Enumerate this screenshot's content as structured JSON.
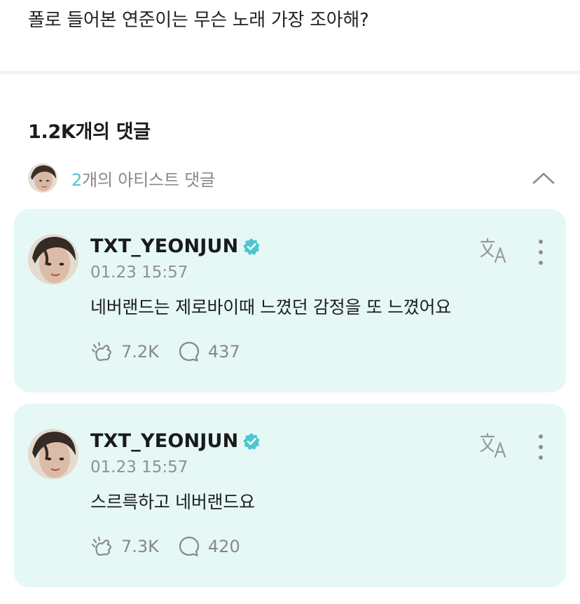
{
  "post": {
    "text": "폴로 들어본 연준이는 무슨 노래 가장 조아해?"
  },
  "comments_header": {
    "count_title": "1.2K개의 댓글",
    "artist_count": "2",
    "artist_label": "개의 아티스트 댓글"
  },
  "comments": [
    {
      "author": "TXT_YEONJUN",
      "time": "01.23 15:57",
      "body": "네버랜드는 제로바이때 느꼈던 감정을 또 느꼈어요",
      "likes": "7.2K",
      "replies": "437"
    },
    {
      "author": "TXT_YEONJUN",
      "time": "01.23 15:57",
      "body": "스르륵하고 네버랜드요",
      "likes": "7.3K",
      "replies": "420"
    }
  ],
  "colors": {
    "card_bg": "#e5f8f5",
    "accent": "#46c6d1",
    "verified_badge": "#4cc6cf"
  },
  "icons": [
    "avatar",
    "chevron-up-icon",
    "verified-badge-icon",
    "translate-icon",
    "more-vertical-icon",
    "cheer-icon",
    "reply-icon"
  ]
}
